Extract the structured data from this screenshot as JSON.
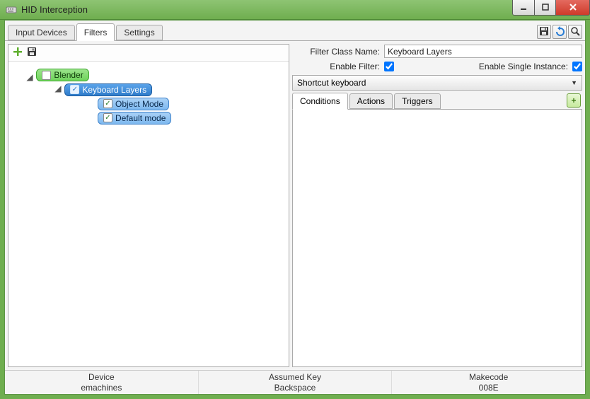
{
  "window": {
    "title": "HID Interception"
  },
  "tabs": {
    "items": [
      "Input Devices",
      "Filters",
      "Settings"
    ],
    "active_index": 1
  },
  "tree": {
    "root": {
      "label": "Blender",
      "checked": false,
      "children": [
        {
          "label": "Keyboard Layers",
          "checked": true,
          "selected": true,
          "children": [
            {
              "label": "Object Mode",
              "checked": true
            },
            {
              "label": "Default mode",
              "checked": true
            }
          ]
        }
      ]
    }
  },
  "filter_form": {
    "class_name_label": "Filter Class Name:",
    "class_name_value": "Keyboard Layers",
    "enable_filter_label": "Enable Filter:",
    "enable_filter_checked": true,
    "enable_single_instance_label": "Enable Single Instance:",
    "enable_single_instance_checked": true,
    "dropdown_value": "Shortcut keyboard"
  },
  "subtabs": {
    "items": [
      "Conditions",
      "Actions",
      "Triggers"
    ],
    "active_index": 0
  },
  "statusbar": {
    "device_label": "Device",
    "device_value": "emachines",
    "assumed_key_label": "Assumed Key",
    "assumed_key_value": "Backspace",
    "makecode_label": "Makecode",
    "makecode_value": "008E"
  },
  "icons": {
    "add": "plus-icon",
    "save": "save-icon",
    "undo": "undo-icon",
    "search": "search-icon"
  }
}
